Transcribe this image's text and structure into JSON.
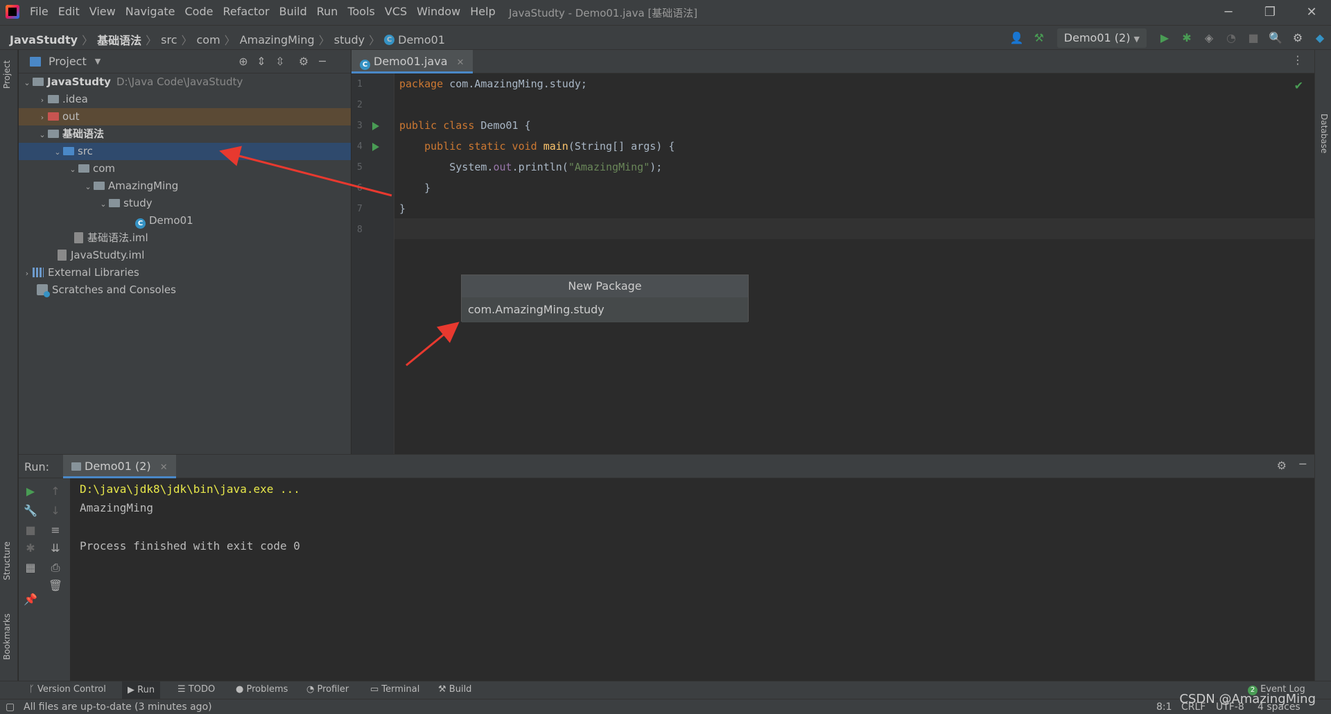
{
  "window": {
    "title": "JavaStudty - Demo01.java [基础语法]",
    "minimize": "─",
    "restore": "❐",
    "close": "✕"
  },
  "menu": [
    "File",
    "Edit",
    "View",
    "Navigate",
    "Code",
    "Refactor",
    "Build",
    "Run",
    "Tools",
    "VCS",
    "Window",
    "Help"
  ],
  "breadcrumb": [
    "JavaStudty",
    "基础语法",
    "src",
    "com",
    "AmazingMing",
    "study",
    "Demo01"
  ],
  "run_config": "Demo01 (2)",
  "project_panel": {
    "title": "Project",
    "tree": [
      {
        "label": "JavaStudty",
        "path": "D:\\Java Code\\JavaStudty"
      },
      {
        "label": ".idea"
      },
      {
        "label": "out"
      },
      {
        "label": "基础语法"
      },
      {
        "label": "src"
      },
      {
        "label": "com"
      },
      {
        "label": "AmazingMing"
      },
      {
        "label": "study"
      },
      {
        "label": "Demo01"
      },
      {
        "label": "基础语法.iml"
      },
      {
        "label": "JavaStudty.iml"
      },
      {
        "label": "External Libraries"
      },
      {
        "label": "Scratches and Consoles"
      }
    ]
  },
  "editor": {
    "tab": "Demo01.java",
    "line_numbers": [
      "1",
      "2",
      "3",
      "4",
      "5",
      "6",
      "7",
      "8"
    ]
  },
  "popup": {
    "title": "New Package",
    "value": "com.AmazingMing.study"
  },
  "run_panel": {
    "label": "Run:",
    "tab": "Demo01 (2)",
    "console": [
      "D:\\java\\jdk8\\jdk\\bin\\java.exe ...",
      "AmazingMing",
      "Process finished with exit code 0"
    ]
  },
  "side_tabs": {
    "project": "Project",
    "structure": "Structure",
    "bookmarks": "Bookmarks",
    "database": "Database"
  },
  "bottom_tools": [
    "Version Control",
    "Run",
    "TODO",
    "Problems",
    "Profiler",
    "Terminal",
    "Build"
  ],
  "event_log": {
    "count": "2",
    "label": "Event Log"
  },
  "status": {
    "message": "All files are up-to-date (3 minutes ago)",
    "position": "8:1",
    "line_sep": "CRLF",
    "encoding": "UTF-8",
    "indent": "4 spaces"
  },
  "watermark": "CSDN @AmazingMing"
}
